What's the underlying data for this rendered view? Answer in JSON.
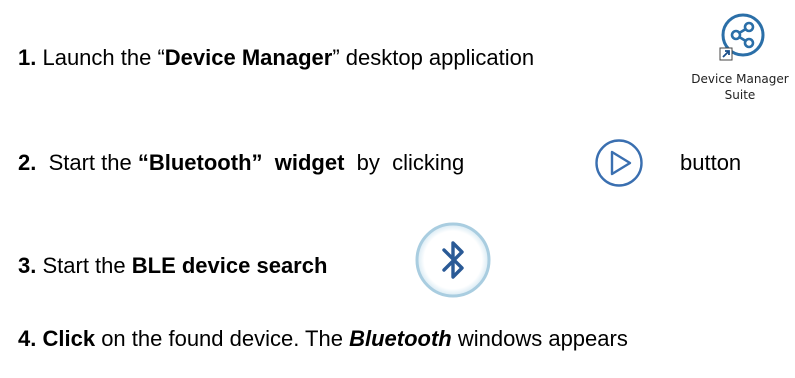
{
  "steps": [
    {
      "number": "1.",
      "text_before": " Launch the “",
      "bold": "Device Manager",
      "text_after": "” desktop application"
    },
    {
      "number": "2.",
      "text_before": "  Start the ",
      "bold": "“Bluetooth”  widget",
      "text_after": "  by  clicking",
      "trailing": "button"
    },
    {
      "number": "3.",
      "text_before": " Start the ",
      "bold": "BLE device search"
    },
    {
      "number": "4.",
      "bold_prefix": "Click",
      "text_before": " on the found device. The ",
      "bold_italic": "Bluetooth",
      "text_after": " windows appears"
    }
  ],
  "desktop_shortcut": {
    "caption": "Device Manager\nSuite",
    "icon": "share-icon",
    "accent": "#2b6fa8"
  },
  "play_button": {
    "icon": "play-icon",
    "color": "#3a6fb0"
  },
  "bluetooth_button": {
    "icon": "bluetooth-icon",
    "ring_color": "#a9cde0",
    "glyph_color": "#2a5a96"
  }
}
